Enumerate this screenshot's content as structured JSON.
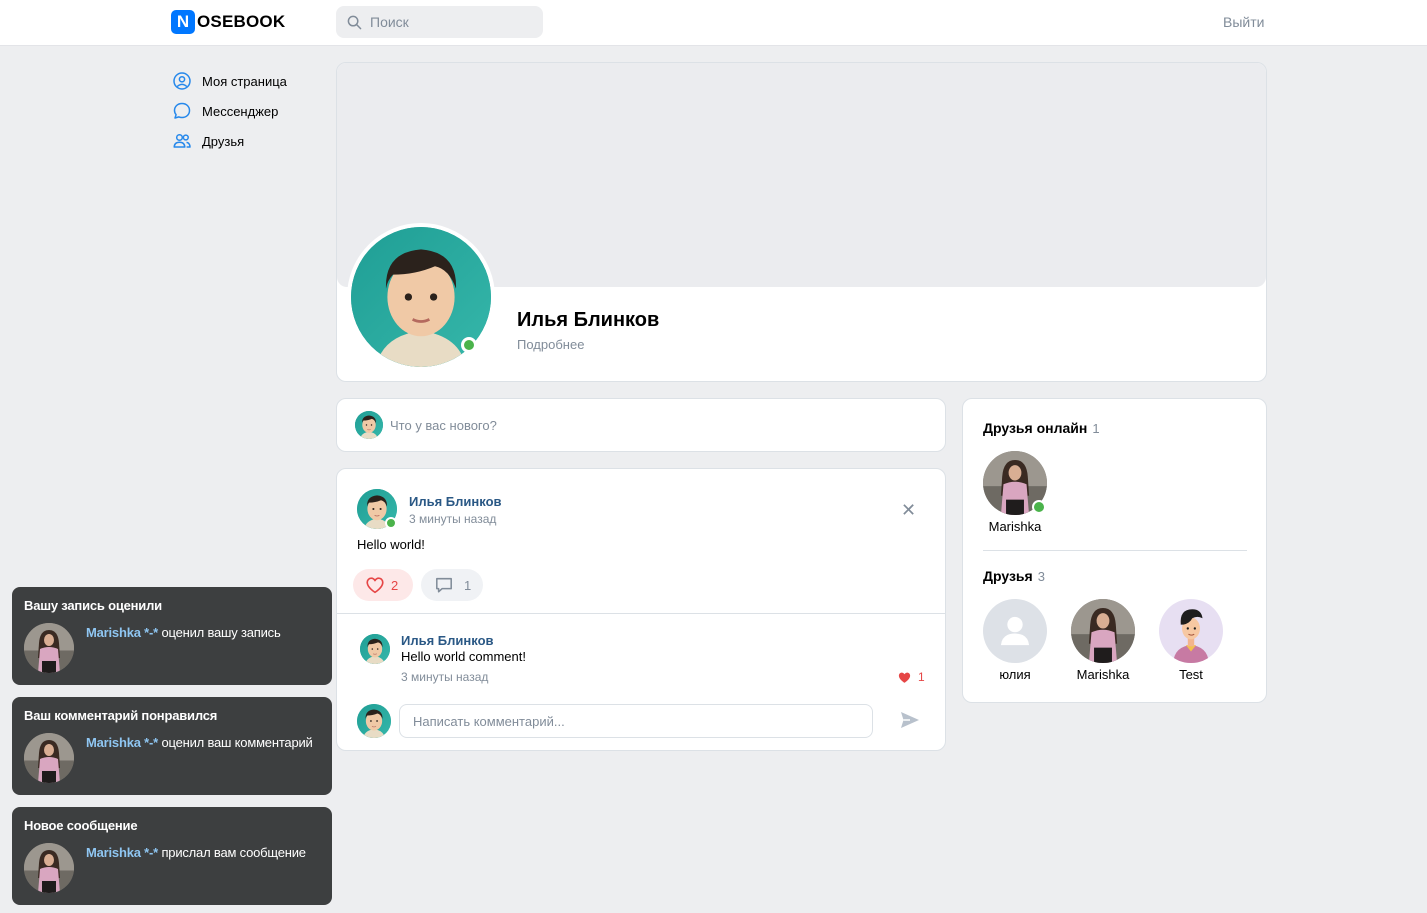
{
  "brand": {
    "logo_letter": "N",
    "logo_text": "OSEBOOK",
    "accent": "#0077ff"
  },
  "header": {
    "search_placeholder": "Поиск",
    "logout": "Выйти"
  },
  "sidebar": {
    "items": [
      {
        "label": "Моя страница",
        "icon": "user-circle-icon"
      },
      {
        "label": "Мессенджер",
        "icon": "message-icon"
      },
      {
        "label": "Друзья",
        "icon": "users-icon"
      }
    ]
  },
  "profile": {
    "name": "Илья Блинков",
    "more": "Подробнее"
  },
  "composer": {
    "placeholder": "Что у вас нового?"
  },
  "post": {
    "author": "Илья Блинков",
    "time": "3 минуты назад",
    "text": "Hello world!",
    "likes": "2",
    "comments": "1",
    "comment": {
      "author": "Илья Блинков",
      "text": "Hello world comment!",
      "time": "3 минуты назад",
      "likes": "1"
    },
    "comment_placeholder": "Написать комментарий..."
  },
  "friends_widget": {
    "online_title": "Друзья онлайн",
    "online_count": "1",
    "online": [
      {
        "name": "Marishka"
      }
    ],
    "all_title": "Друзья",
    "all_count": "3",
    "all": [
      {
        "name": "юлия"
      },
      {
        "name": "Marishka"
      },
      {
        "name": "Test"
      }
    ]
  },
  "toasts": [
    {
      "title": "Вашу запись оценили",
      "name": "Marishka *-*",
      "text": " оценил вашу запись"
    },
    {
      "title": "Ваш комментарий понравился",
      "name": "Marishka *-*",
      "text": " оценил ваш комментарий"
    },
    {
      "title": "Новое сообщение",
      "name": "Marishka *-*",
      "text": " прислал вам сообщение"
    }
  ]
}
